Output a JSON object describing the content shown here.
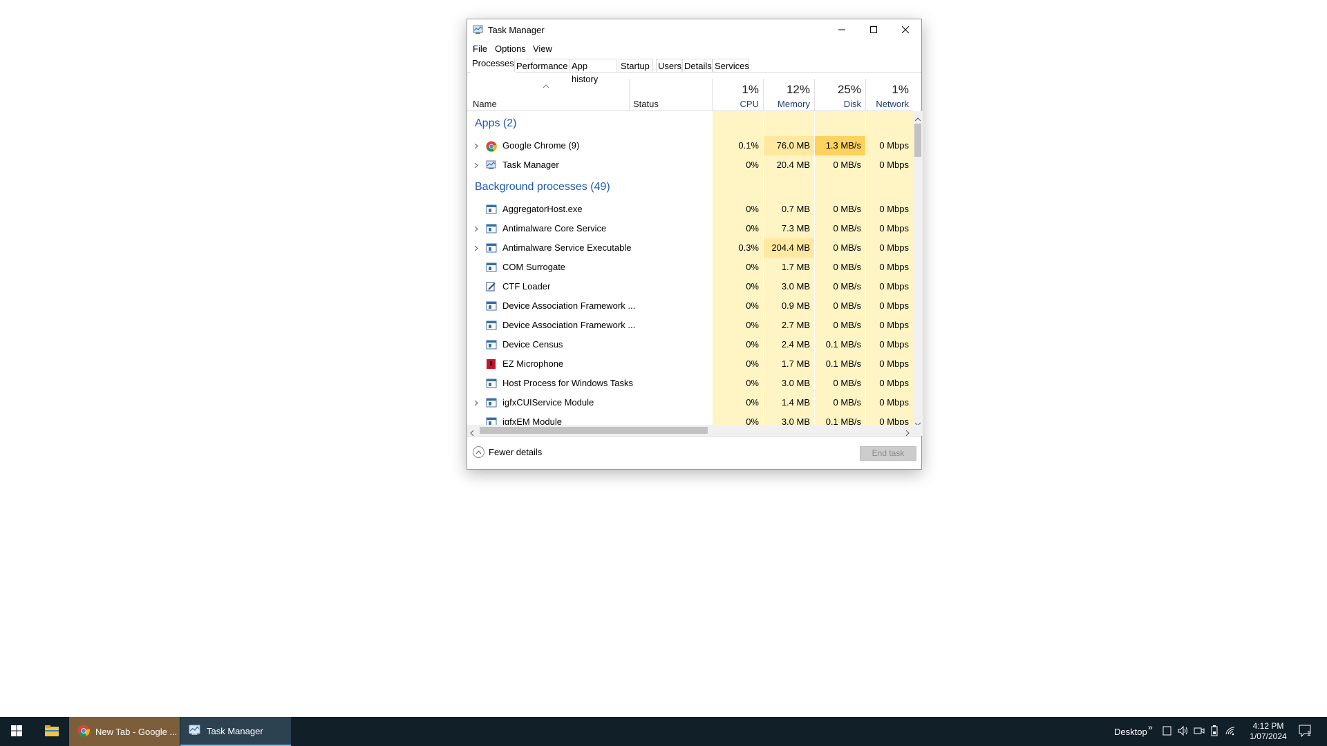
{
  "window": {
    "title": "Task Manager",
    "controls": {
      "minimize": "minimize",
      "maximize": "maximize",
      "close": "close"
    }
  },
  "menu": [
    "File",
    "Options",
    "View"
  ],
  "tabs": [
    "Processes",
    "Performance",
    "App history",
    "Startup",
    "Users",
    "Details",
    "Services"
  ],
  "active_tab": "Processes",
  "columns": {
    "name": "Name",
    "status": "Status",
    "cpu": {
      "pct": "1%",
      "label": "CPU"
    },
    "memory": {
      "pct": "12%",
      "label": "Memory"
    },
    "disk": {
      "pct": "25%",
      "label": "Disk"
    },
    "network": {
      "pct": "1%",
      "label": "Network"
    }
  },
  "groups": {
    "apps": "Apps (2)",
    "background": "Background processes (49)"
  },
  "apps": [
    {
      "name": "Google Chrome (9)",
      "icon": "chrome-icon",
      "expandable": true,
      "cpu": "0.1%",
      "memory": "76.0 MB",
      "disk": "1.3 MB/s",
      "network": "0 Mbps"
    },
    {
      "name": "Task Manager",
      "icon": "task-manager-icon",
      "expandable": true,
      "cpu": "0%",
      "memory": "20.4 MB",
      "disk": "0 MB/s",
      "network": "0 Mbps"
    }
  ],
  "background": [
    {
      "name": "AggregatorHost.exe",
      "icon": "process-icon",
      "expandable": false,
      "cpu": "0%",
      "memory": "0.7 MB",
      "disk": "0 MB/s",
      "network": "0 Mbps"
    },
    {
      "name": "Antimalware Core Service",
      "icon": "process-icon",
      "expandable": true,
      "cpu": "0%",
      "memory": "7.3 MB",
      "disk": "0 MB/s",
      "network": "0 Mbps"
    },
    {
      "name": "Antimalware Service Executable",
      "icon": "process-icon",
      "expandable": true,
      "cpu": "0.3%",
      "memory": "204.4 MB",
      "disk": "0 MB/s",
      "network": "0 Mbps"
    },
    {
      "name": "COM Surrogate",
      "icon": "process-icon",
      "expandable": false,
      "cpu": "0%",
      "memory": "1.7 MB",
      "disk": "0 MB/s",
      "network": "0 Mbps"
    },
    {
      "name": "CTF Loader",
      "icon": "ctf-loader-icon",
      "expandable": false,
      "cpu": "0%",
      "memory": "3.0 MB",
      "disk": "0 MB/s",
      "network": "0 Mbps"
    },
    {
      "name": "Device Association Framework ...",
      "icon": "process-icon",
      "expandable": false,
      "cpu": "0%",
      "memory": "0.9 MB",
      "disk": "0 MB/s",
      "network": "0 Mbps"
    },
    {
      "name": "Device Association Framework ...",
      "icon": "process-icon",
      "expandable": false,
      "cpu": "0%",
      "memory": "2.7 MB",
      "disk": "0 MB/s",
      "network": "0 Mbps"
    },
    {
      "name": "Device Census",
      "icon": "process-icon",
      "expandable": false,
      "cpu": "0%",
      "memory": "2.4 MB",
      "disk": "0.1 MB/s",
      "network": "0 Mbps"
    },
    {
      "name": "EZ Microphone",
      "icon": "ez-microphone-icon",
      "expandable": false,
      "cpu": "0%",
      "memory": "1.7 MB",
      "disk": "0.1 MB/s",
      "network": "0 Mbps"
    },
    {
      "name": "Host Process for Windows Tasks",
      "icon": "process-icon",
      "expandable": false,
      "cpu": "0%",
      "memory": "3.0 MB",
      "disk": "0 MB/s",
      "network": "0 Mbps"
    },
    {
      "name": "igfxCUIService Module",
      "icon": "process-icon",
      "expandable": true,
      "cpu": "0%",
      "memory": "1.4 MB",
      "disk": "0 MB/s",
      "network": "0 Mbps"
    },
    {
      "name": "igfxEM Module",
      "icon": "process-icon",
      "expandable": false,
      "cpu": "0%",
      "memory": "3.0 MB",
      "disk": "0.1 MB/s",
      "network": "0 Mbps"
    }
  ],
  "footer": {
    "fewer_details": "Fewer details",
    "end_task": "End task"
  },
  "taskbar": {
    "apps": [
      {
        "label": "New Tab - Google ...",
        "icon": "chrome-icon"
      },
      {
        "label": "Task Manager",
        "icon": "task-manager-icon"
      }
    ],
    "desktop_label": "Desktop",
    "overflow": "»",
    "time": "4:12 PM",
    "date": "1/07/2024",
    "notification_count": "1"
  },
  "colors": {
    "heat_low": "#fff4c4",
    "heat_mid": "#ffe8a0",
    "heat_high": "#ffd25e",
    "group_title": "#1c57b5",
    "taskbar": "#101f28"
  }
}
